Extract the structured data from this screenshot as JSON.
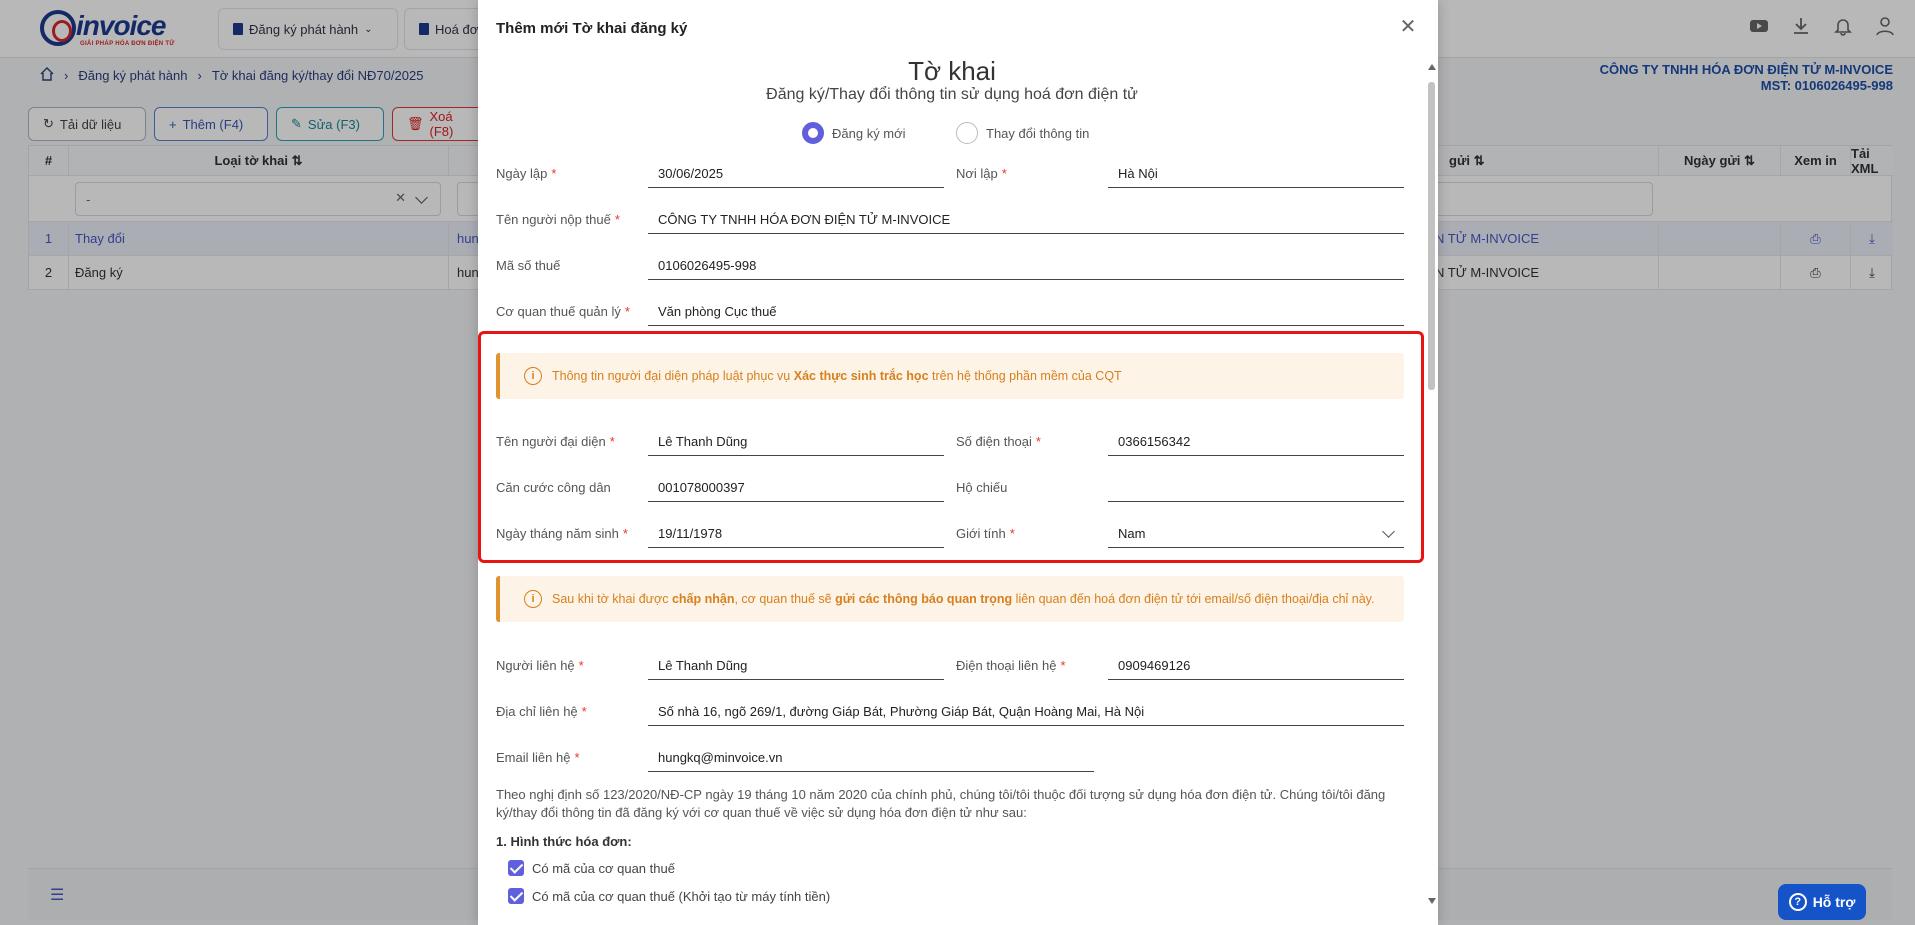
{
  "app": {
    "logo_text": "invoice",
    "logo_sub": "GIẢI PHÁP HÓA ĐƠN ĐIỆN TỬ",
    "nav": [
      "Đăng ký phát hành",
      "Hoá đơn"
    ],
    "breadcrumb": [
      "Đăng ký phát hành",
      "Tờ khai đăng ký/thay đổi NĐ70/2025"
    ],
    "company_name": "CÔNG TY TNHH HÓA ĐƠN ĐIỆN TỬ M-INVOICE",
    "company_mst": "MST: 0106026495-998",
    "toolbar": {
      "reload": "Tải dữ liệu",
      "add": "Thêm (F4)",
      "edit": "Sửa (F3)",
      "delete": "Xoá (F8)"
    },
    "grid": {
      "headers": {
        "num": "#",
        "type": "Loại tờ khai",
        "sender": "gửi",
        "send_date": "Ngày gửi",
        "view": "Xem in",
        "xml": "Tải XML"
      },
      "filter_value": "-",
      "rows": [
        {
          "num": "1",
          "type": "Thay đổi",
          "user": "hun",
          "name": "N TỬ M-INVOICE"
        },
        {
          "num": "2",
          "type": "Đăng ký",
          "user": "hun",
          "name": "N TỬ M-INVOICE"
        }
      ]
    },
    "support": "Hỗ trợ"
  },
  "modal": {
    "title": "Thêm mới Tờ khai đăng ký",
    "form_title": "Tờ khai",
    "form_subtitle": "Đăng ký/Thay đổi thông tin sử dụng hoá đơn điện tử",
    "radio_register": "Đăng ký mới",
    "radio_change": "Thay đổi thông tin",
    "fields": {
      "ngay_lap": {
        "label": "Ngày lập",
        "value": "30/06/2025"
      },
      "noi_lap": {
        "label": "Nơi lập",
        "value": "Hà Nội"
      },
      "ten_nnt": {
        "label": "Tên người nộp thuế",
        "value": "CÔNG TY TNHH HÓA ĐƠN ĐIỆN TỬ M-INVOICE"
      },
      "mst": {
        "label": "Mã số thuế",
        "value": "0106026495-998"
      },
      "cqt": {
        "label": "Cơ quan thuế quản lý",
        "value": "Văn phòng Cục thuế"
      },
      "ten_dd": {
        "label": "Tên người đại diện",
        "value": "Lê Thanh Dũng"
      },
      "sdt": {
        "label": "Số điện thoại",
        "value": "0366156342"
      },
      "cccd": {
        "label": "Căn cước công dân",
        "value": "001078000397"
      },
      "ho_chieu": {
        "label": "Hộ chiếu",
        "value": ""
      },
      "ngay_sinh": {
        "label": "Ngày tháng năm sinh",
        "value": "19/11/1978"
      },
      "gioi_tinh": {
        "label": "Giới tính",
        "value": "Nam"
      },
      "nguoi_lh": {
        "label": "Người liên hệ",
        "value": "Lê Thanh Dũng"
      },
      "dt_lh": {
        "label": "Điện thoại liên hệ",
        "value": "0909469126"
      },
      "dia_chi": {
        "label": "Địa chỉ liên hệ",
        "value": "Số nhà 16, ngõ 269/1, đường Giáp Bát, Phường Giáp Bát, Quận Hoàng Mai, Hà Nội"
      },
      "email": {
        "label": "Email liên hệ",
        "value": "hungkq@minvoice.vn"
      }
    },
    "alert1": {
      "pre": "Thông tin người đại diện pháp luật phục vụ ",
      "bold": "Xác thực sinh trắc học",
      "post": " trên hệ thống phần mềm của CQT"
    },
    "alert2": {
      "p1": "Sau khi tờ khai được ",
      "b1": "chấp nhận",
      "p2": ", cơ quan thuế sẽ ",
      "b2": "gửi các thông báo quan trọng",
      "p3": " liên quan đến hoá đơn điện tử tới email/số điện thoại/địa chỉ này."
    },
    "paragraph": "Theo nghị định số 123/2020/NĐ-CP ngày 19 tháng 10 năm 2020 của chính phủ, chúng tôi/tôi thuộc đối tượng sử dụng hóa đơn điện tử. Chúng tôi/tôi đăng ký/thay đổi thông tin đã đăng ký với cơ quan thuế về việc sử dụng hóa đơn điện tử như sau:",
    "section1": "1. Hình thức hóa đơn:",
    "check1": "Có mã của cơ quan thuế",
    "check2": "Có mã của cơ quan thuế (Khởi tạo từ máy tính tiền)"
  }
}
